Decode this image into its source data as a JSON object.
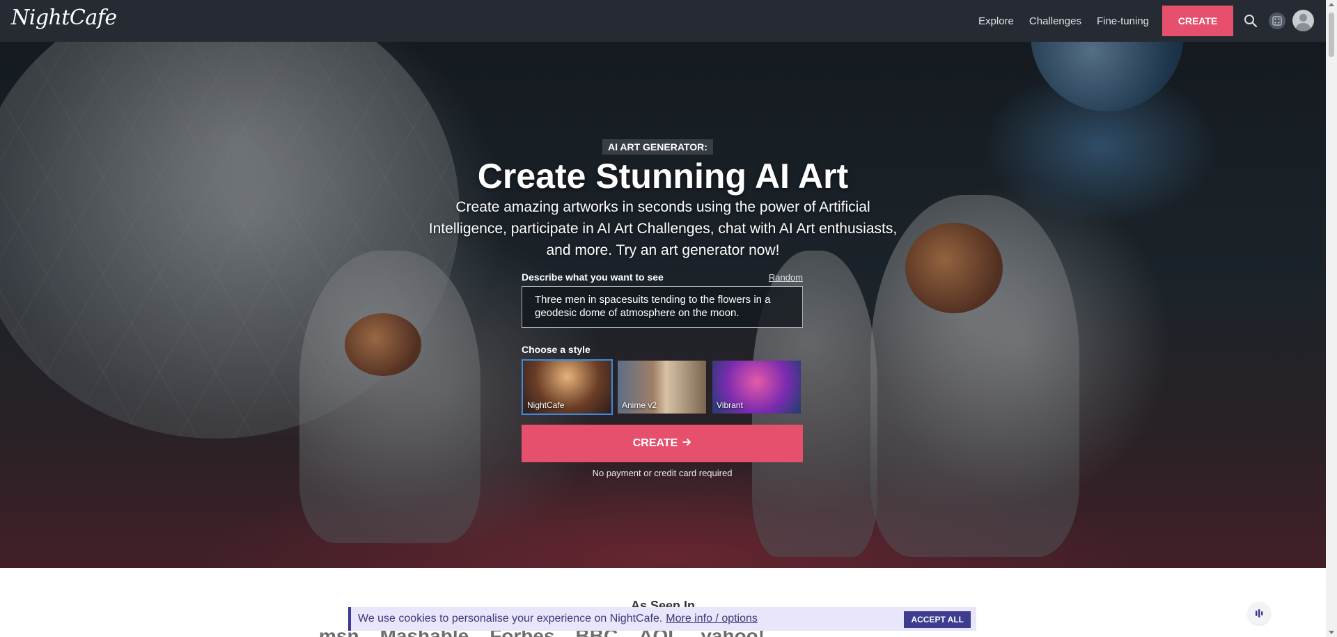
{
  "nav": {
    "logo": "NightCafe",
    "links": [
      "Explore",
      "Challenges",
      "Fine-tuning"
    ],
    "create_label": "CREATE",
    "icons": [
      "search-icon",
      "dice-icon",
      "avatar"
    ]
  },
  "hero": {
    "badge": "AI ART GENERATOR:",
    "title": "Create Stunning AI Art",
    "description": "Create amazing artworks in seconds using the power of Artificial Intelligence, participate in AI Art Challenges, chat with AI Art enthusiasts, and more. Try an art generator now!",
    "prompt_label": "Describe what you want to see",
    "random_label": "Random",
    "prompt_value": "Three men in spacesuits tending to the flowers in a geodesic dome of atmosphere on the moon.",
    "style_label": "Choose a style",
    "styles": [
      "NightCafe",
      "Anime v2",
      "Vibrant"
    ],
    "selected_style": "NightCafe",
    "create_label": "CREATE",
    "note": "No payment or credit card required"
  },
  "seen_in": {
    "title": "As Seen In",
    "logos": [
      "msn",
      "Mashable",
      "Forbes",
      "BBC",
      "",
      "",
      "AOL",
      "yahoo!"
    ]
  },
  "cookie": {
    "text": "We use cookies to personalise your experience on NightCafe.",
    "link": "More info / options",
    "accept_label": "ACCEPT ALL"
  },
  "colors": {
    "nav_bg": "#262b33",
    "accent": "#e6506d",
    "cookie_bg": "#e9e6fb",
    "cookie_accent": "#3e3c8f",
    "selected_border": "#3c8bdc"
  }
}
